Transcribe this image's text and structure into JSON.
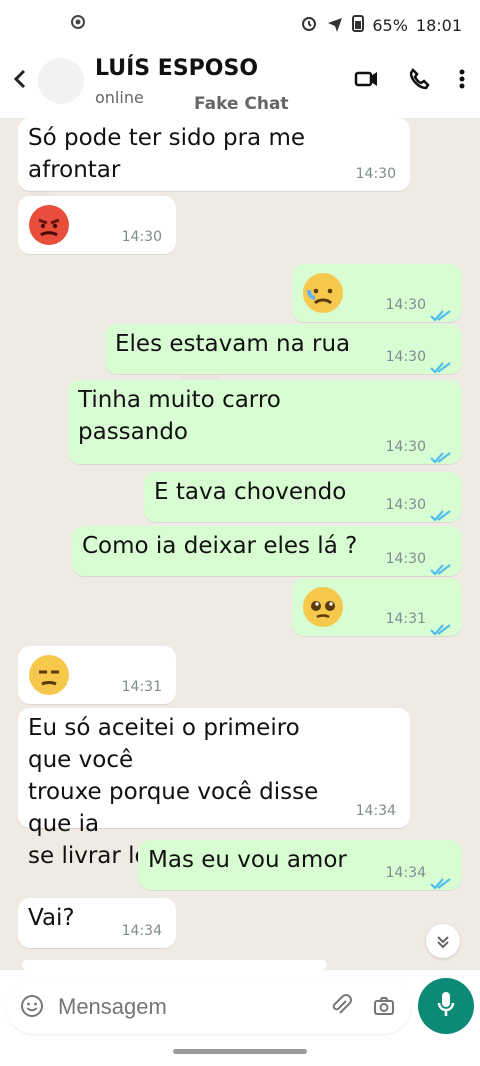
{
  "status": {
    "battery": "65%",
    "time": "18:01"
  },
  "header": {
    "name": "LUÍS ESPOSO",
    "status": "online",
    "watermark": "Fake Chat"
  },
  "messages": [
    {
      "kind": "in",
      "text": "Só pode ter sido pra me afrontar",
      "time": "14:30"
    },
    {
      "kind": "in",
      "emoji": "angry",
      "time": "14:30"
    },
    {
      "kind": "out",
      "emoji": "sad",
      "time": "14:30"
    },
    {
      "kind": "out",
      "text": "Eles estavam na rua",
      "time": "14:30"
    },
    {
      "kind": "out",
      "text": "Tinha muito carro passando",
      "time": "14:30"
    },
    {
      "kind": "out",
      "text": "E tava chovendo",
      "time": "14:30"
    },
    {
      "kind": "out",
      "text": "Como ia deixar eles lá ?",
      "time": "14:30"
    },
    {
      "kind": "out",
      "emoji": "pleading",
      "time": "14:31"
    },
    {
      "kind": "in",
      "emoji": "unamused",
      "time": "14:31"
    },
    {
      "kind": "in",
      "text": "Eu só aceitei o primeiro que você\ntrouxe porque você disse que ia\nse livrar logo",
      "time": "14:34"
    },
    {
      "kind": "out",
      "text": "Mas eu vou amor",
      "time": "14:34"
    },
    {
      "kind": "in",
      "text": "Vai?",
      "time": "14:34"
    }
  ],
  "input": {
    "placeholder": "Mensagem"
  },
  "colors": {
    "incoming": "#ffffff",
    "outgoing": "#d9fdd3",
    "accent": "#0c8a76",
    "tick_blue": "#53bdeb"
  }
}
